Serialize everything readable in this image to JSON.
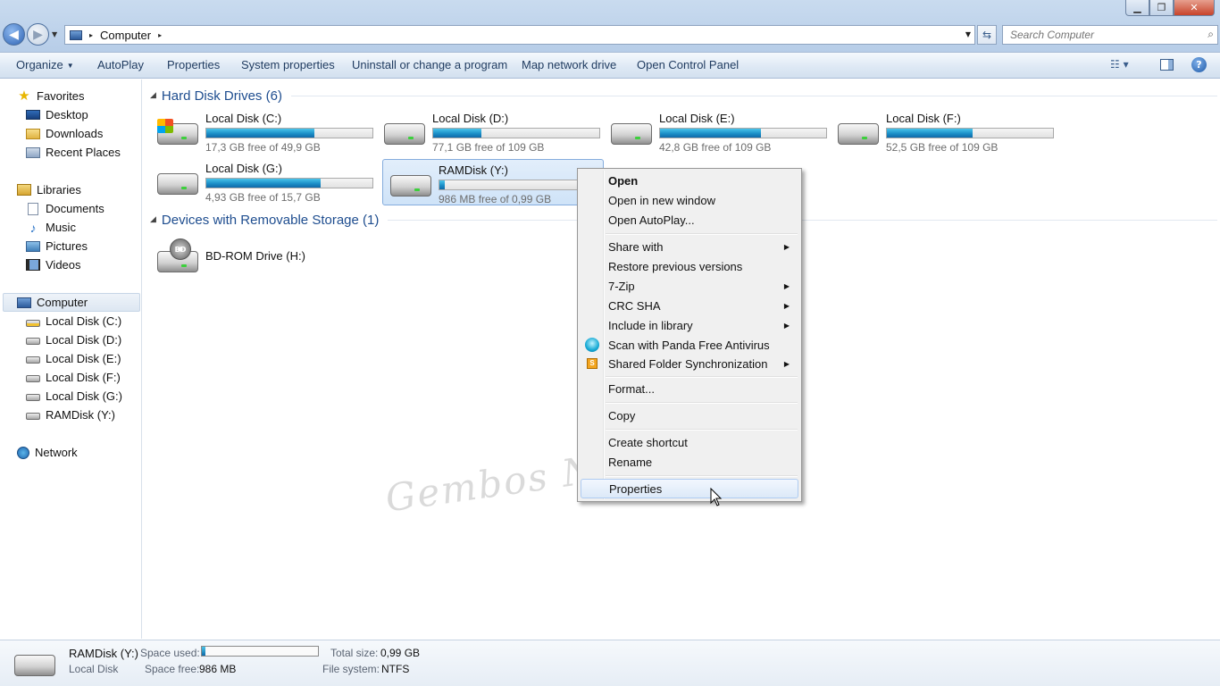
{
  "window": {
    "minimize_glyph": "▁",
    "maximize_glyph": "❐",
    "close_glyph": "✕"
  },
  "nav": {
    "back_glyph": "◀",
    "forward_glyph": "▶",
    "recent_glyph": "▼",
    "address": {
      "crumb": "Computer",
      "separator": "▸",
      "dropdown_glyph": "▼"
    },
    "refresh_glyph": "⇆",
    "search": {
      "placeholder": "Search Computer",
      "icon": "search-icon",
      "glyph": "⌕"
    }
  },
  "toolbar": {
    "organize": "Organize",
    "organize_caret": "▼",
    "autoplay": "AutoPlay",
    "properties": "Properties",
    "system_properties": "System properties",
    "uninstall": "Uninstall or change a program",
    "map_drive": "Map network drive",
    "control_panel": "Open Control Panel",
    "views_glyph": "☷ ▾",
    "help_glyph": "?"
  },
  "sidebar": {
    "favorites": {
      "label": "Favorites",
      "icon": "star-icon",
      "glyph": "★"
    },
    "favorites_items": [
      {
        "label": "Desktop",
        "icon": "desktop-icon"
      },
      {
        "label": "Downloads",
        "icon": "folder-icon"
      },
      {
        "label": "Recent Places",
        "icon": "recent-places-icon"
      }
    ],
    "libraries": {
      "label": "Libraries",
      "icon": "library-icon"
    },
    "library_items": [
      {
        "label": "Documents",
        "icon": "document-icon"
      },
      {
        "label": "Music",
        "icon": "music-icon",
        "glyph": "♪"
      },
      {
        "label": "Pictures",
        "icon": "picture-icon"
      },
      {
        "label": "Videos",
        "icon": "video-icon"
      }
    ],
    "computer": {
      "label": "Computer",
      "icon": "computer-icon"
    },
    "computer_items": [
      {
        "label": "Local Disk (C:)",
        "icon": "system-drive-icon"
      },
      {
        "label": "Local Disk (D:)",
        "icon": "drive-icon"
      },
      {
        "label": "Local Disk (E:)",
        "icon": "drive-icon"
      },
      {
        "label": "Local Disk (F:)",
        "icon": "drive-icon"
      },
      {
        "label": "Local Disk (G:)",
        "icon": "drive-icon"
      },
      {
        "label": "RAMDisk (Y:)",
        "icon": "drive-icon"
      }
    ],
    "network": {
      "label": "Network",
      "icon": "network-icon"
    }
  },
  "content": {
    "groups": [
      {
        "title": "Hard Disk Drives (6)",
        "toggle_glyph": "◢"
      },
      {
        "title": "Devices with Removable Storage (1)",
        "toggle_glyph": "◢"
      }
    ],
    "drives": [
      {
        "name": "Local Disk (C:)",
        "free_text": "17,3 GB free of 49,9 GB",
        "used_fraction": 0.653,
        "system": true
      },
      {
        "name": "Local Disk (D:)",
        "free_text": "77,1 GB free of 109 GB",
        "used_fraction": 0.293
      },
      {
        "name": "Local Disk (E:)",
        "free_text": "42,8 GB free of 109 GB",
        "used_fraction": 0.607
      },
      {
        "name": "Local Disk (F:)",
        "free_text": "52,5 GB free of 109 GB",
        "used_fraction": 0.518
      },
      {
        "name": "Local Disk (G:)",
        "free_text": "4,93 GB free of 15,7 GB",
        "used_fraction": 0.686
      },
      {
        "name": "RAMDisk (Y:)",
        "free_text": "986 MB free of 0,99 GB",
        "used_fraction": 0.03,
        "selected": true
      }
    ],
    "removable": [
      {
        "name": "BD-ROM Drive (H:)",
        "icon": "bd-rom-icon",
        "badge": "BD"
      }
    ]
  },
  "context_menu": {
    "submenu_glyph": "▶",
    "items": [
      {
        "label": "Open",
        "bold": true
      },
      {
        "label": "Open in new window"
      },
      {
        "label": "Open AutoPlay..."
      },
      {
        "label": "Share with",
        "submenu": true
      },
      {
        "label": "Restore previous versions"
      },
      {
        "label": "7-Zip",
        "submenu": true
      },
      {
        "label": "CRC SHA",
        "submenu": true
      },
      {
        "label": "Include in library",
        "submenu": true
      },
      {
        "label": "Scan with Panda Free Antivirus",
        "icon": "panda-antivirus-icon"
      },
      {
        "label": "Shared Folder Synchronization",
        "submenu": true,
        "icon": "sync-icon",
        "icon_glyph": "S"
      },
      {
        "label": "Format..."
      },
      {
        "label": "Copy"
      },
      {
        "label": "Create shortcut"
      },
      {
        "label": "Rename"
      },
      {
        "label": "Properties",
        "highlighted": true
      }
    ]
  },
  "watermark": "Gembos Nge Blog",
  "details": {
    "name": "RAMDisk (Y:)",
    "type": "Local Disk",
    "space_used_label": "Space used:",
    "space_used_fraction": 0.03,
    "space_free_label": "Space free:",
    "space_free": "986 MB",
    "total_size_label": "Total size:",
    "total_size": "0,99 GB",
    "file_system_label": "File system:",
    "file_system": "NTFS"
  }
}
